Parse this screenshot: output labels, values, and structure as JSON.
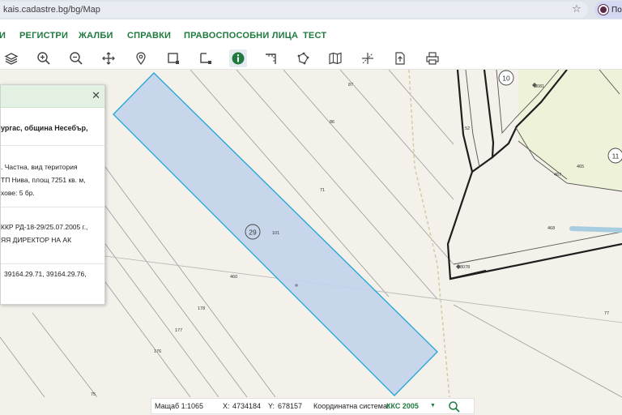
{
  "browser": {
    "url": "kais.cadastre.bg/bg/Map",
    "profile_label": "По"
  },
  "nav": {
    "items": [
      "И",
      "РЕГИСТРИ",
      "ЖАЛБИ",
      "СПРАВКИ",
      "ПРАВОСПОСОБНИ ЛИЦА",
      "ТЕСТ"
    ]
  },
  "toolbar": {
    "tools": [
      "layers-icon",
      "zoom-in-icon",
      "zoom-out-icon",
      "pan-icon",
      "location-pin-icon",
      "select-rectangle-icon",
      "select-area-icon",
      "info-icon",
      "measure-icon",
      "polygon-icon",
      "map-book-icon",
      "coordinates-icon",
      "export-icon",
      "print-icon"
    ],
    "active_tool": "info-icon"
  },
  "info_panel": {
    "address_line1": "ургас, община Несебър,",
    "address_line2": "",
    "desc_line1": ". Частна, вид територия",
    "desc_line2": "ТП Нива, площ 7251 кв. м,",
    "desc_line3": "хове: 5 бр.",
    "order_line1": "ККР РД-18-29/25.07.2005 г.,",
    "order_line2": "ЯЯ ДИРЕКТОР НА АК",
    "neighbors_line": "39164.29.71,    39164.29.76,"
  },
  "map": {
    "parcel_number": "29",
    "highlight_fill": "#c3d3ec",
    "highlight_stroke": "#2aa8d8",
    "labels": {
      "n10": "10",
      "n11": "11",
      "n3081": "3081",
      "n3078": "3078",
      "n87": "87",
      "n86": "86",
      "n71": "71",
      "n101": "101",
      "n52": "52",
      "n467": "467",
      "n465": "465",
      "n468": "468",
      "n460": "460",
      "n178": "178",
      "n177": "177",
      "n176": "176",
      "n77": "77",
      "n75": "75"
    }
  },
  "status": {
    "scale_label": "Мащаб 1:",
    "scale_value": "1065",
    "x_label": "X:",
    "x_value": "4734184",
    "y_label": "Y:",
    "y_value": "678157",
    "crs_label": "Координатна система:",
    "crs_value": "ККС 2005"
  },
  "colors": {
    "accent_green": "#1f7a3e",
    "map_bg": "#f3f1ea",
    "field_green": "#eef2d8"
  }
}
